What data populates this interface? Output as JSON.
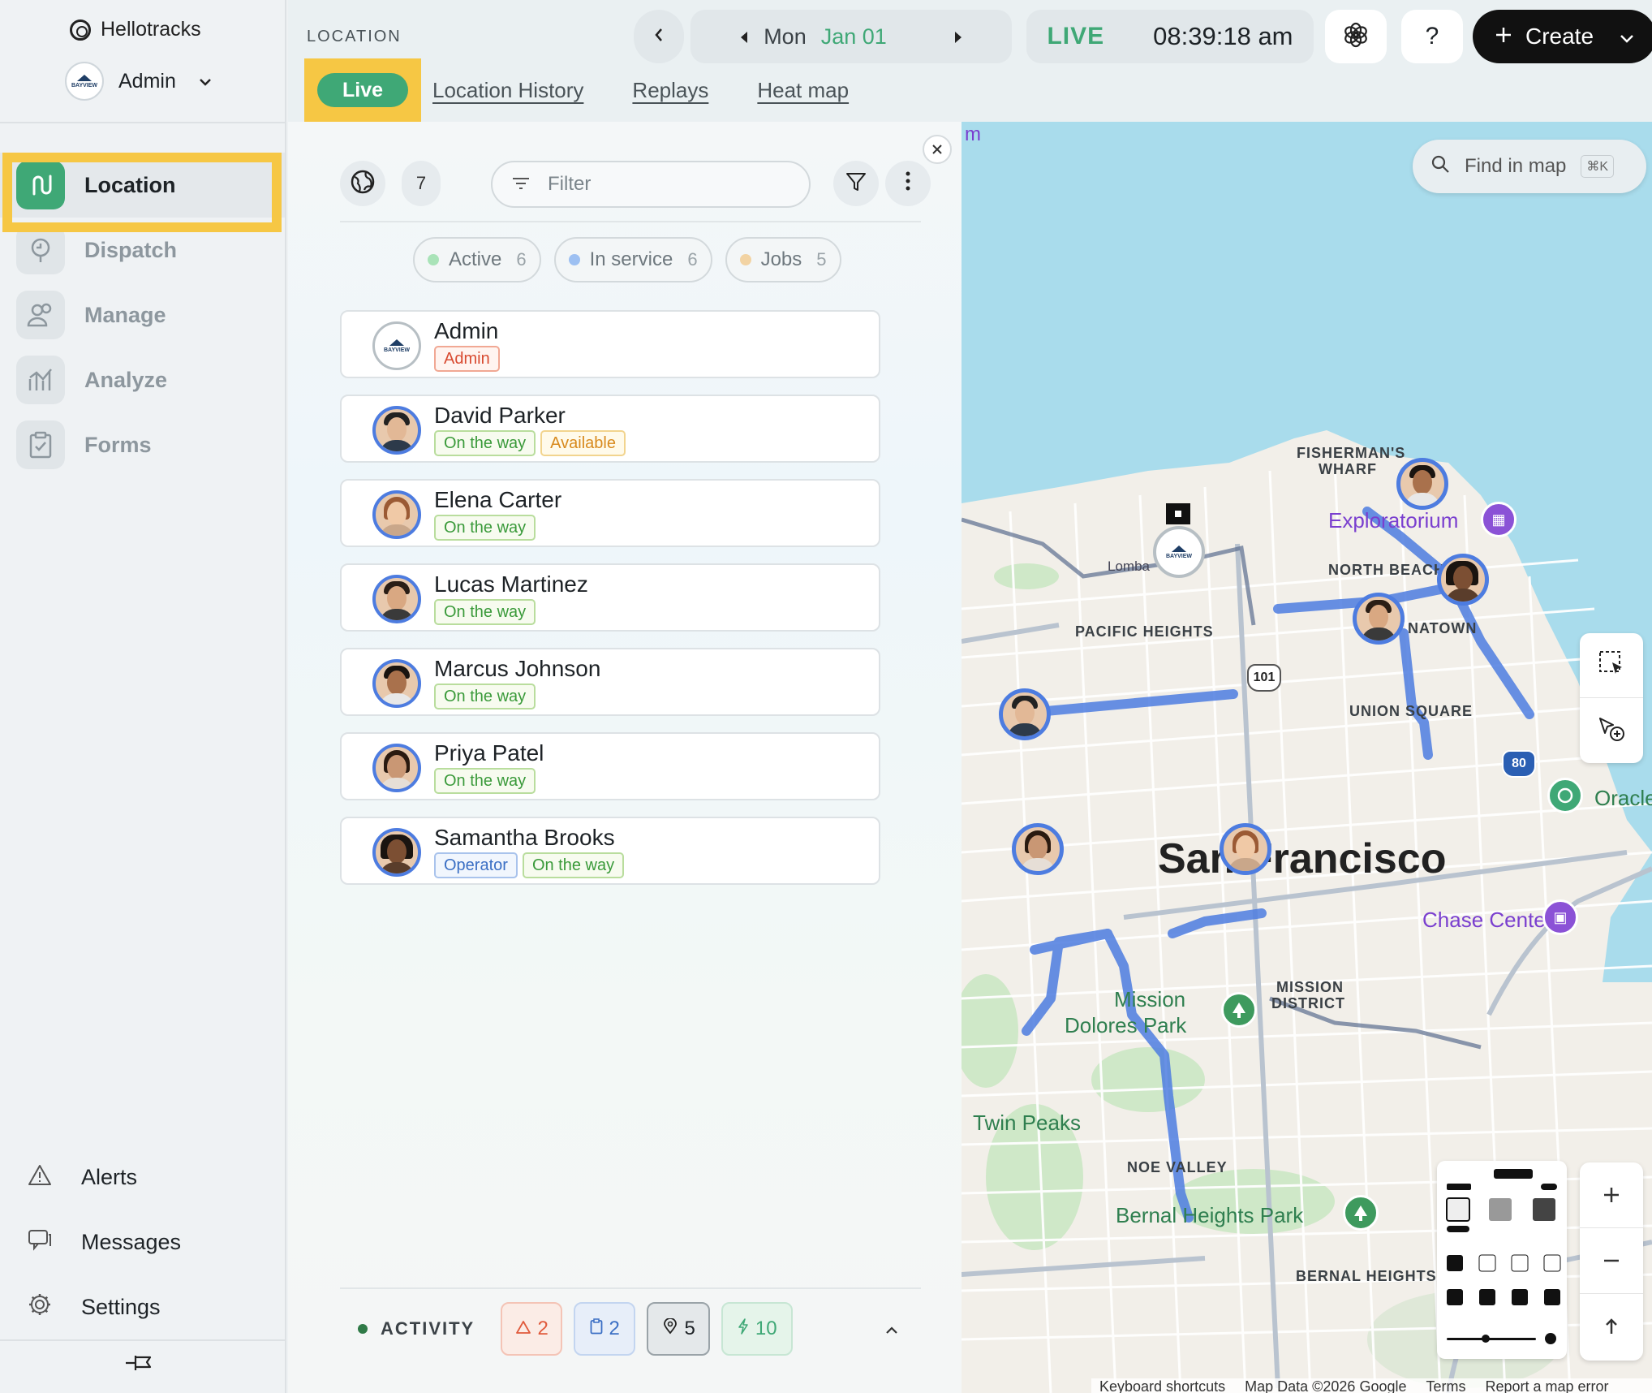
{
  "app": {
    "name": "Hellotracks",
    "account": "Admin",
    "org_logo_text": "BAYVIEW"
  },
  "nav": {
    "items": [
      {
        "label": "Location",
        "icon": "route-icon",
        "active": true
      },
      {
        "label": "Dispatch",
        "icon": "dispatch-icon",
        "active": false
      },
      {
        "label": "Manage",
        "icon": "people-icon",
        "active": false
      },
      {
        "label": "Analyze",
        "icon": "chart-icon",
        "active": false
      },
      {
        "label": "Forms",
        "icon": "clipboard-icon",
        "active": false
      }
    ],
    "bottom": [
      {
        "label": "Alerts",
        "icon": "warning-icon"
      },
      {
        "label": "Messages",
        "icon": "chat-icon"
      },
      {
        "label": "Settings",
        "icon": "gear-icon"
      }
    ]
  },
  "header": {
    "section": "LOCATION",
    "tabs": [
      "Live",
      "Location History",
      "Replays",
      "Heat map"
    ],
    "day": "Mon",
    "date": "Jan 01",
    "live": "LIVE",
    "time": "08:39:18 am",
    "help": "?",
    "create": "Create"
  },
  "panel": {
    "count": "7",
    "filter_placeholder": "Filter",
    "chips": [
      {
        "label": "Active",
        "count": "6",
        "color": "#a9e3b8"
      },
      {
        "label": "In service",
        "count": "6",
        "color": "#9dc0f2"
      },
      {
        "label": "Jobs",
        "count": "5",
        "color": "#f2d3a3"
      }
    ],
    "people": [
      {
        "name": "Admin",
        "tags": [
          {
            "text": "Admin",
            "style": "red"
          }
        ]
      },
      {
        "name": "David Parker",
        "tags": [
          {
            "text": "On the way",
            "style": "green"
          },
          {
            "text": "Available",
            "style": "orange"
          }
        ]
      },
      {
        "name": "Elena Carter",
        "tags": [
          {
            "text": "On the way",
            "style": "green"
          }
        ]
      },
      {
        "name": "Lucas Martinez",
        "tags": [
          {
            "text": "On the way",
            "style": "green"
          }
        ]
      },
      {
        "name": "Marcus Johnson",
        "tags": [
          {
            "text": "On the way",
            "style": "green"
          }
        ]
      },
      {
        "name": "Priya Patel",
        "tags": [
          {
            "text": "On the way",
            "style": "green"
          }
        ]
      },
      {
        "name": "Samantha Brooks",
        "tags": [
          {
            "text": "Operator",
            "style": "blue"
          },
          {
            "text": "On the way",
            "style": "green"
          }
        ]
      }
    ],
    "activity": {
      "label": "ACTIVITY",
      "alerts": "2",
      "forms": "2",
      "locations": "5",
      "events": "10"
    }
  },
  "map": {
    "search_placeholder": "Find in map",
    "search_shortcut": "⌘K",
    "labels": {
      "fishermans_wharf_1": "FISHERMAN'S",
      "fishermans_wharf_2": "WHARF",
      "exploratorium": "Exploratorium",
      "north_beach": "NORTH BEACH",
      "chinatown": "NATOWN",
      "pacific_heights": "PACIFIC HEIGHTS",
      "union_square": "UNION SQUARE",
      "lombard": "Lomba",
      "city": "San Francisco",
      "chase_center": "Chase Center",
      "oracle": "Oracle",
      "mission_district_1": "MISSION",
      "mission_district_2": "DISTRICT",
      "dolores_park_1": "Mission",
      "dolores_park_2": "Dolores Park",
      "twin_peaks": "Twin Peaks",
      "noe_valley": "NOE VALLEY",
      "bernal_park": "Bernal Heights Park",
      "bernal_heights": "BERNAL HEIGHTS",
      "corner": "m",
      "hwy_101": "101",
      "hwy_80": "80"
    },
    "footer": [
      "Keyboard shortcuts",
      "Map Data ©2026 Google",
      "Terms",
      "Report a map error"
    ]
  },
  "colors": {
    "accent_green": "#3fa876",
    "highlight_yellow": "#f6c744",
    "route_blue": "#4d7ce0",
    "poi_purple": "#8b52d6"
  }
}
